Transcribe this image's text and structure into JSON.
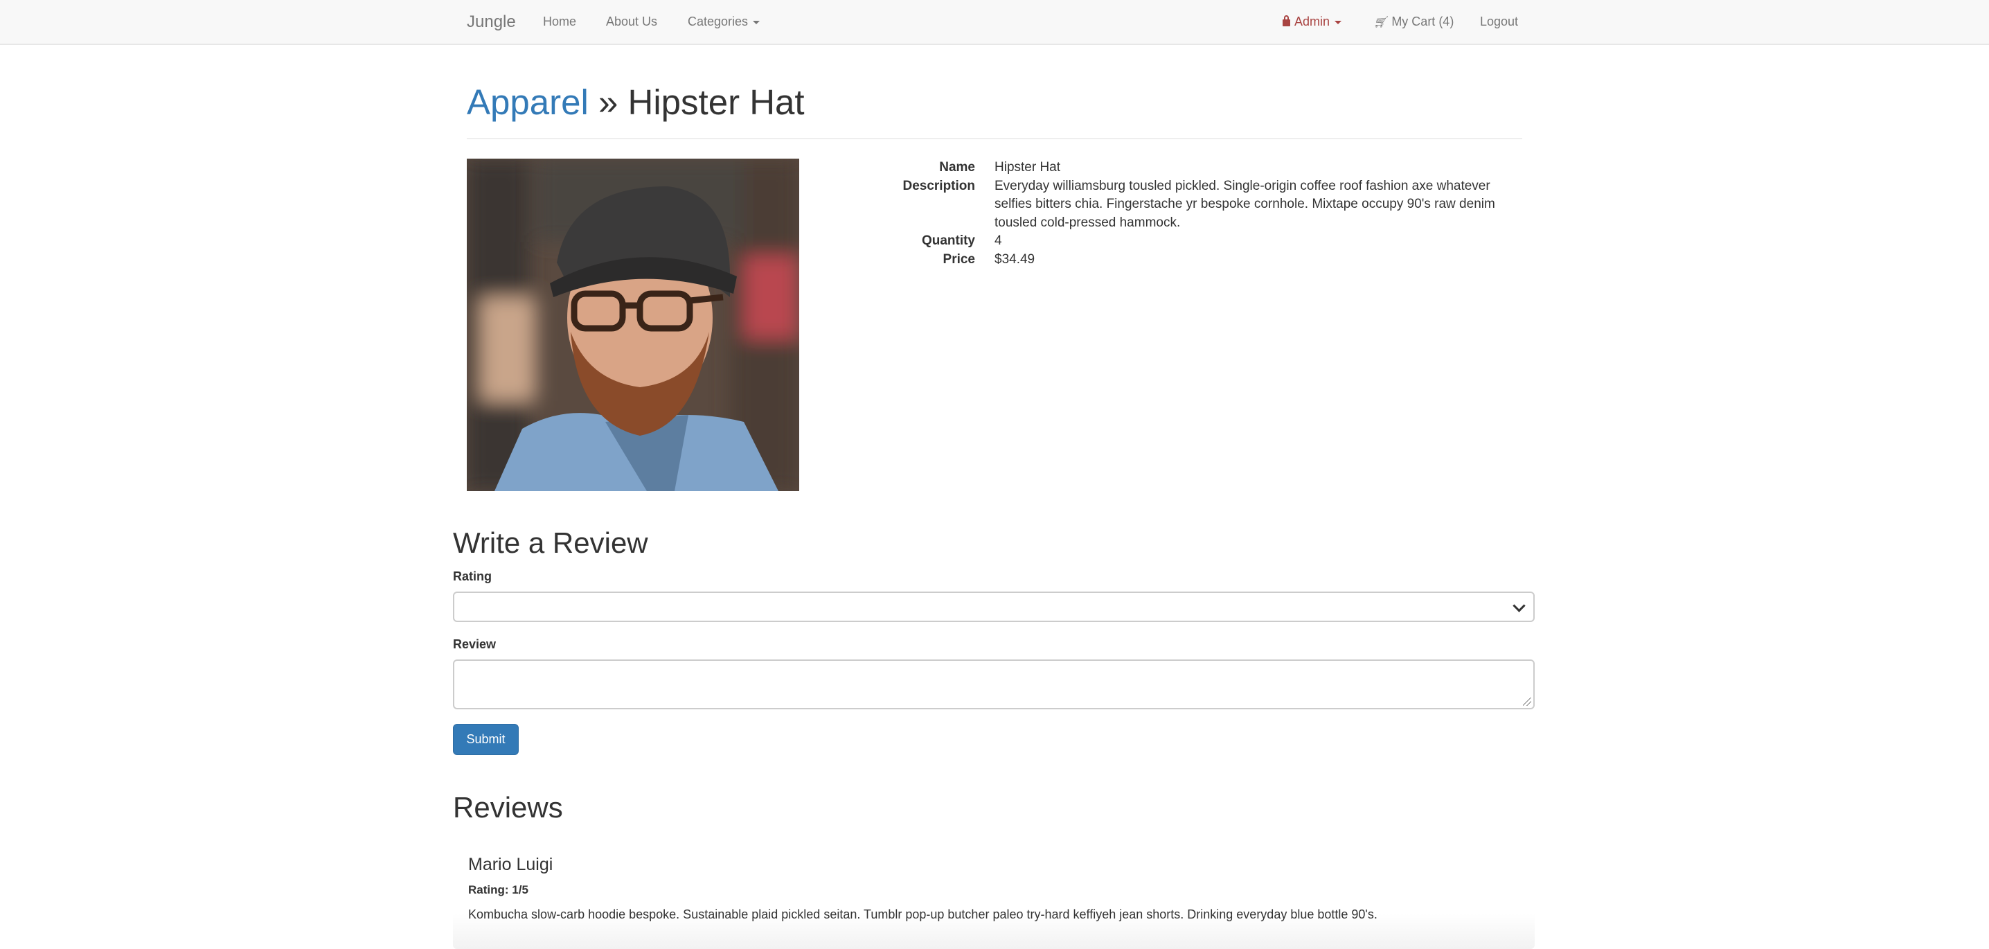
{
  "navbar": {
    "brand": "Jungle",
    "home": "Home",
    "about": "About Us",
    "categories": "Categories",
    "admin": "Admin",
    "cart": "My Cart (4)",
    "logout": "Logout"
  },
  "header": {
    "category": "Apparel",
    "separator": "»",
    "product": "Hipster Hat"
  },
  "product": {
    "labels": {
      "name": "Name",
      "description": "Description",
      "quantity": "Quantity",
      "price": "Price"
    },
    "name": "Hipster Hat",
    "description": "Everyday williamsburg tousled pickled. Single-origin coffee roof fashion axe whatever selfies bitters chia. Fingerstache yr bespoke cornhole. Mixtape occupy 90's raw denim tousled cold-pressed hammock.",
    "quantity": "4",
    "price": "$34.49"
  },
  "review_form": {
    "title": "Write a Review",
    "rating_label": "Rating",
    "rating_value": "",
    "review_label": "Review",
    "review_value": "",
    "submit": "Submit"
  },
  "reviews": {
    "title": "Reviews",
    "items": [
      {
        "author": "Mario Luigi",
        "rating": "Rating: 1/5",
        "text": "Kombucha slow-carb hoodie bespoke. Sustainable plaid pickled seitan. Tumblr pop-up butcher paleo try-hard keffiyeh jean shorts. Drinking everyday blue bottle 90's."
      }
    ]
  }
}
